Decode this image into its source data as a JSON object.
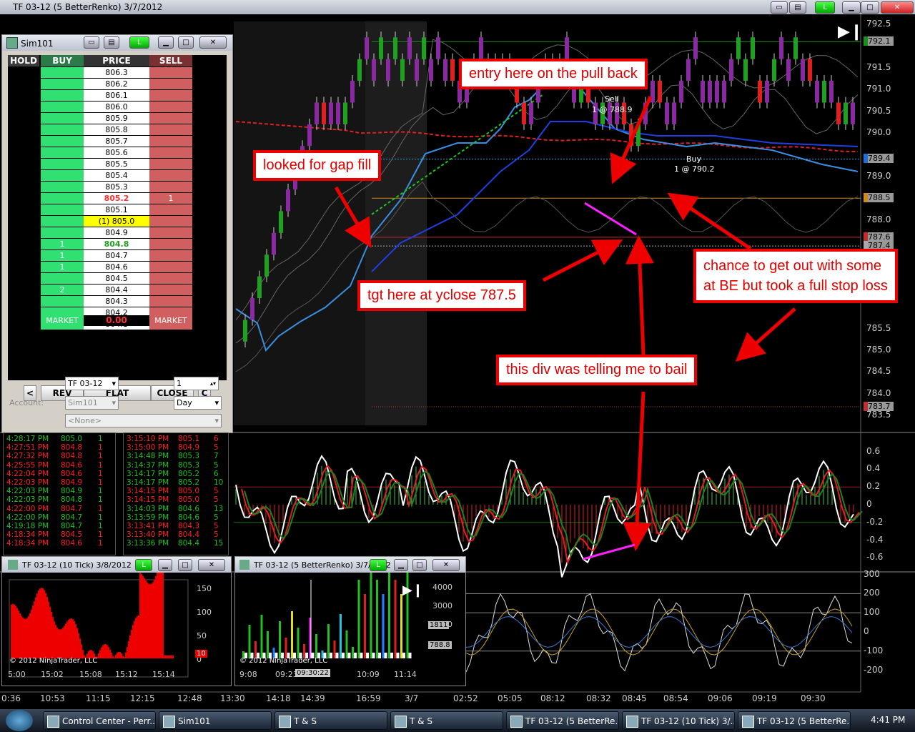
{
  "window": {
    "title": "TF 03-12 (5 BetterRenko)  3/7/2012",
    "link_label": "L"
  },
  "price_axis": {
    "labels": [
      "792.5",
      "791.5",
      "791.0",
      "790.5",
      "790.0",
      "789.0",
      "788.0",
      "785.5",
      "785.0",
      "784.5",
      "784.0",
      "783.5"
    ],
    "labels_y_value": [
      792.5,
      791.5,
      791.0,
      790.5,
      790.0,
      789.0,
      788.0,
      785.5,
      785.0,
      784.5,
      784.0,
      783.5
    ],
    "markers": [
      {
        "text": "792.1",
        "color": "#1a8f1a"
      },
      {
        "text": "789.4",
        "color": "#1f6fd6"
      },
      {
        "text": "788.5",
        "color": "#d08a20"
      },
      {
        "text": "787.6",
        "color": "#c03030"
      },
      {
        "text": "787.4",
        "color": "#aaaaaa"
      },
      {
        "text": "783.7",
        "color": "#c03030"
      }
    ]
  },
  "osc_axis": {
    "labels": [
      "0.6",
      "0.4",
      "0.2",
      "0",
      "-0.2",
      "-0.4",
      "-0.6"
    ]
  },
  "cci_axis": {
    "labels": [
      "300",
      "200",
      "100",
      "0",
      "-100",
      "-200"
    ]
  },
  "time_axis": {
    "labels": [
      "0:36",
      "10:53",
      "11:15",
      "12:15",
      "12:48",
      "13:30",
      "14:18",
      "14:39",
      "16:59",
      "3/7",
      "02:52",
      "05:05",
      "08:12",
      "08:32",
      "08:45",
      "08:54",
      "09:06",
      "09:19",
      "09:30"
    ]
  },
  "trades": {
    "sell_label": "Sell",
    "sell_detail": "1 @ 788.9",
    "buy_label": "Buy",
    "buy_detail": "1 @ 790.2"
  },
  "callouts": {
    "entry": "entry here on the pull back",
    "gap": "looked for gap fill",
    "tgt": "tgt here at yclose 787.5",
    "chance_line1": "chance to get out with some",
    "chance_line2": "at BE but took a full stop loss",
    "div": "this div was telling me to bail"
  },
  "superdom": {
    "title": "Sim101",
    "link_label": "L",
    "headers": {
      "hold": "HOLD",
      "buy": "BUY",
      "price": "PRICE",
      "sell": "SELL"
    },
    "rows": [
      {
        "price": "806.3",
        "buy": "",
        "sell": ""
      },
      {
        "price": "806.2",
        "buy": "",
        "sell": ""
      },
      {
        "price": "806.1",
        "buy": "",
        "sell": ""
      },
      {
        "price": "806.0",
        "buy": "",
        "sell": ""
      },
      {
        "price": "805.9",
        "buy": "",
        "sell": ""
      },
      {
        "price": "805.8",
        "buy": "",
        "sell": ""
      },
      {
        "price": "805.7",
        "buy": "",
        "sell": ""
      },
      {
        "price": "805.6",
        "buy": "",
        "sell": ""
      },
      {
        "price": "805.5",
        "buy": "",
        "sell": ""
      },
      {
        "price": "805.4",
        "buy": "",
        "sell": ""
      },
      {
        "price": "805.3",
        "buy": "",
        "sell": ""
      },
      {
        "price": "805.2",
        "buy": "",
        "sell": "1",
        "style": "ask"
      },
      {
        "price": "805.1",
        "buy": "",
        "sell": ""
      },
      {
        "price": "(1) 805.0",
        "buy": "",
        "sell": "",
        "style": "last"
      },
      {
        "price": "804.9",
        "buy": "",
        "sell": ""
      },
      {
        "price": "804.8",
        "buy": "1",
        "sell": "",
        "style": "bid"
      },
      {
        "price": "804.7",
        "buy": "1",
        "sell": ""
      },
      {
        "price": "804.6",
        "buy": "1",
        "sell": ""
      },
      {
        "price": "804.5",
        "buy": "",
        "sell": ""
      },
      {
        "price": "804.4",
        "buy": "2",
        "sell": ""
      },
      {
        "price": "804.3",
        "buy": "",
        "sell": ""
      },
      {
        "price": "804.2",
        "buy": "",
        "sell": ""
      },
      {
        "price": "804.1",
        "buy": "",
        "sell": ""
      }
    ],
    "market_buy": "MARKET",
    "pnl": "0.00",
    "market_sell": "MARKET",
    "buttons": {
      "left": "<",
      "rev": "REV",
      "flat": "FLAT",
      "close": "CLOSE",
      "right": "C"
    },
    "instrument": "TF 03-12",
    "quantity": "1",
    "account_label": "Account:",
    "account": "Sim101",
    "tif": "Day",
    "strategy": "<None>"
  },
  "ts_left": [
    {
      "time": "4:28:17 PM",
      "price": "805.0",
      "size": "1",
      "color": "#20c020"
    },
    {
      "time": "4:27:51 PM",
      "price": "804.8",
      "size": "1",
      "color": "#ff2020"
    },
    {
      "time": "4:27:32 PM",
      "price": "804.8",
      "size": "1",
      "color": "#ff2020"
    },
    {
      "time": "4:25:55 PM",
      "price": "804.6",
      "size": "1",
      "color": "#ff2020"
    },
    {
      "time": "4:22:04 PM",
      "price": "804.6",
      "size": "1",
      "color": "#ff2020"
    },
    {
      "time": "4:22:03 PM",
      "price": "804.9",
      "size": "1",
      "color": "#ff2020"
    },
    {
      "time": "4:22:03 PM",
      "price": "804.9",
      "size": "1",
      "color": "#20c020"
    },
    {
      "time": "4:22:03 PM",
      "price": "804.8",
      "size": "1",
      "color": "#20c020"
    },
    {
      "time": "4:22:00 PM",
      "price": "804.7",
      "size": "1",
      "color": "#ff2020"
    },
    {
      "time": "4:22:00 PM",
      "price": "804.7",
      "size": "1",
      "color": "#20c020"
    },
    {
      "time": "4:19:18 PM",
      "price": "804.7",
      "size": "1",
      "color": "#20c020"
    },
    {
      "time": "4:18:34 PM",
      "price": "804.5",
      "size": "1",
      "color": "#ff2020"
    },
    {
      "time": "4:18:34 PM",
      "price": "804.6",
      "size": "1",
      "color": "#ff2020"
    }
  ],
  "ts_right": [
    {
      "time": "3:15:10 PM",
      "price": "805.1",
      "size": "6",
      "color": "#ff2020"
    },
    {
      "time": "3:15:00 PM",
      "price": "804.9",
      "size": "5",
      "color": "#ff2020"
    },
    {
      "time": "3:14:48 PM",
      "price": "805.3",
      "size": "7",
      "color": "#20c020"
    },
    {
      "time": "3:14:37 PM",
      "price": "805.3",
      "size": "5",
      "color": "#20c020"
    },
    {
      "time": "3:14:17 PM",
      "price": "805.2",
      "size": "6",
      "color": "#20c020"
    },
    {
      "time": "3:14:17 PM",
      "price": "805.2",
      "size": "10",
      "color": "#20c020"
    },
    {
      "time": "3:14:15 PM",
      "price": "805.0",
      "size": "5",
      "color": "#ff2020"
    },
    {
      "time": "3:14:15 PM",
      "price": "805.0",
      "size": "5",
      "color": "#ff2020"
    },
    {
      "time": "3:14:03 PM",
      "price": "804.6",
      "size": "13",
      "color": "#20c020"
    },
    {
      "time": "3:13:59 PM",
      "price": "804.6",
      "size": "5",
      "color": "#20c020"
    },
    {
      "time": "3:13:41 PM",
      "price": "804.3",
      "size": "5",
      "color": "#ff2020"
    },
    {
      "time": "3:13:40 PM",
      "price": "804.4",
      "size": "5",
      "color": "#ff2020"
    },
    {
      "time": "3:13:36 PM",
      "price": "804.4",
      "size": "15",
      "color": "#20c020"
    }
  ],
  "mini1": {
    "title": "TF 03-12 (10 Tick)  3/8/2012",
    "copyright": "© 2012 NinjaTrader, LLC",
    "y_labels": [
      "150",
      "100",
      "50",
      "0"
    ],
    "marker": "10",
    "x_labels": [
      "5:00",
      "15:02",
      "15:08",
      "15:12",
      "15:14"
    ],
    "link_label": "L"
  },
  "mini2": {
    "title": "TF 03-12 (5 BetterRenko)  3/7/2012",
    "copyright": "© 2012 NinjaTrader, LLC",
    "y_labels": [
      "4000",
      "3000",
      "2000"
    ],
    "markers": [
      "1811",
      "788.8"
    ],
    "x_labels": [
      "9:08",
      "09:23",
      "10:09",
      "11:14"
    ],
    "cursor_time": "09:30:22",
    "link_label": "L"
  },
  "taskbar": [
    {
      "label": "Control Center - Perr..."
    },
    {
      "label": "Sim101"
    },
    {
      "label": "T & S"
    },
    {
      "label": "T & S"
    },
    {
      "label": "TF 03-12 (5 BetterRe..."
    },
    {
      "label": "TF 03-12 (10 Tick)  3/..."
    },
    {
      "label": "TF 03-12 (5 BetterRe..."
    }
  ],
  "clock": "4:41 PM",
  "colors": {
    "callout_red": "#e00000",
    "buy_green": "#30e070",
    "sell_red": "#d06060",
    "ask_text": "#ff3030",
    "bid_text": "#20a020",
    "last_bg": "#ffff00"
  }
}
